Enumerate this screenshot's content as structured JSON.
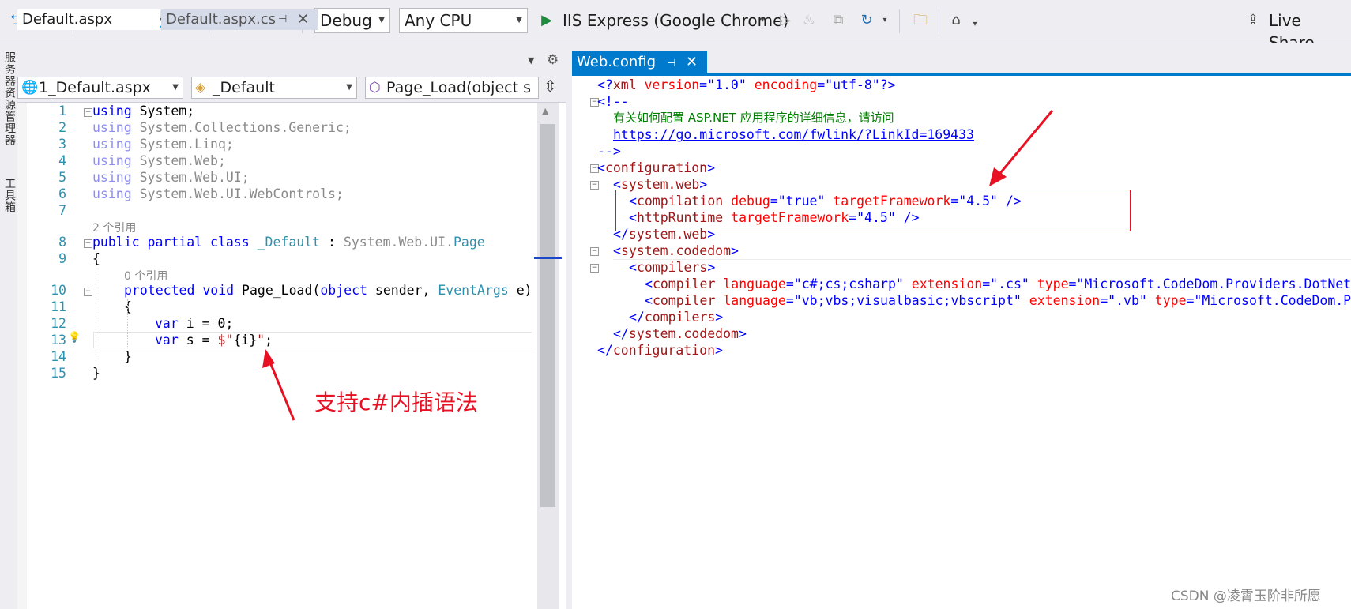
{
  "toolbar": {
    "config": "Debug",
    "platform": "Any CPU",
    "run_target": "IIS Express (Google Chrome)",
    "live_share": "Live Share"
  },
  "left_strip": {
    "item1": "服务器资源管理器",
    "item2": "工具箱"
  },
  "left_tabs": {
    "tab1": "Default.aspx",
    "tab2": "Default.aspx.cs"
  },
  "nav": {
    "project": "1_Default.aspx",
    "class": "_Default",
    "member": "Page_Load(object s"
  },
  "left_code": {
    "line_numbers": [
      "1",
      "2",
      "3",
      "4",
      "5",
      "6",
      "7",
      "8",
      "9",
      "10",
      "11",
      "12",
      "13",
      "14",
      "15"
    ],
    "ref2": "2 个引用",
    "ref0": "0 个引用",
    "l1a": "using",
    "l1b": " System;",
    "l2a": "using",
    "l2b": " System.Collections.Generic;",
    "l3a": "using",
    "l3b": " System.Linq;",
    "l4a": "using",
    "l4b": " System.Web;",
    "l5a": "using",
    "l5b": " System.Web.UI;",
    "l6a": "using",
    "l6b": " System.Web.UI.WebControls;",
    "l8a": "public partial class",
    "l8b": " _Default",
    "l8c": " : ",
    "l8d": "System.Web.UI.",
    "l8e": "Page",
    "l9": "{",
    "l10a": "protected void",
    "l10b": " Page_Load(",
    "l10c": "object",
    "l10d": " sender, ",
    "l10e": "EventArgs",
    "l10f": " e)",
    "l11": "{",
    "l12a": "var",
    "l12b": " i = 0;",
    "l13a": "var",
    "l13b": " s = ",
    "l13c": "$\"",
    "l13d": "{i}",
    "l13e": "\"",
    "l13f": ";",
    "l14": "}",
    "l15": "}"
  },
  "annotation": "支持c#内插语法",
  "right_tab": {
    "title": "Web.config"
  },
  "xml": {
    "r1a": "<?",
    "r1b": "xml",
    "r1c": " version",
    "r1d": "=\"",
    "r1e": "1.0",
    "r1f": "\"",
    "r1g": " encoding",
    "r1h": "=\"",
    "r1i": "utf-8",
    "r1j": "\"",
    "r1k": "?>",
    "r2": "<!--",
    "r3": "有关如何配置 ASP.NET 应用程序的详细信息，请访问",
    "r4": "https://go.microsoft.com/fwlink/?LinkId=169433",
    "r5": "-->",
    "r6a": "<",
    "r6b": "configuration",
    "r6c": ">",
    "r7a": "<",
    "r7b": "system.web",
    "r7c": ">",
    "r8a": "<",
    "r8b": "compilation",
    "r8c": " debug",
    "r8d": "=\"",
    "r8e": "true",
    "r8f": "\"",
    "r8g": " targetFramework",
    "r8h": "=\"",
    "r8i": "4.5",
    "r8j": "\" />",
    "r9a": "<",
    "r9b": "httpRuntime",
    "r9c": " targetFramework",
    "r9d": "=\"",
    "r9e": "4.5",
    "r9f": "\" />",
    "r10a": "</",
    "r10b": "system.web",
    "r10c": ">",
    "r11a": "<",
    "r11b": "system.codedom",
    "r11c": ">",
    "r12a": "<",
    "r12b": "compilers",
    "r12c": ">",
    "r13a": "<",
    "r13b": "compiler",
    "r13c": " language",
    "r13d": "=\"",
    "r13e": "c#;cs;csharp",
    "r13f": "\"",
    "r13g": " extension",
    "r13h": "=\"",
    "r13i": ".cs",
    "r13j": "\"",
    "r13k": " type",
    "r13l": "=\"",
    "r13m": "Microsoft.CodeDom.Providers.DotNetC",
    "r14a": "<",
    "r14b": "compiler",
    "r14c": " language",
    "r14d": "=\"",
    "r14e": "vb;vbs;visualbasic;vbscript",
    "r14f": "\"",
    "r14g": " extension",
    "r14h": "=\"",
    "r14i": ".vb",
    "r14j": "\"",
    "r14k": " type",
    "r14l": "=\"",
    "r14m": "Microsoft.CodeDom.Pr",
    "r15a": "</",
    "r15b": "compilers",
    "r15c": ">",
    "r16a": "</",
    "r16b": "system.codedom",
    "r16c": ">",
    "r17a": "</",
    "r17b": "configuration",
    "r17c": ">"
  },
  "watermark": "CSDN @凌霄玉阶非所愿",
  "colors": {
    "accent": "#007acc",
    "annotation": "#e81123"
  }
}
